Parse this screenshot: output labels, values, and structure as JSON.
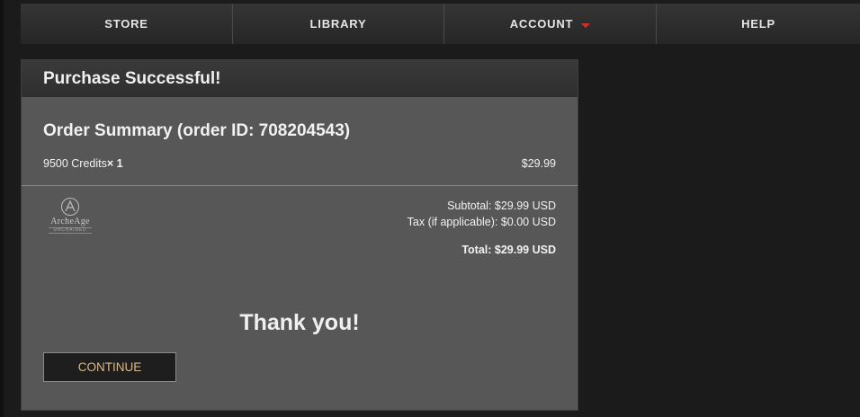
{
  "nav": {
    "items": [
      {
        "label": "STORE"
      },
      {
        "label": "LIBRARY"
      },
      {
        "label": "ACCOUNT"
      },
      {
        "label": "HELP"
      }
    ]
  },
  "panel": {
    "header": "Purchase Successful!",
    "order_summary": "Order Summary (order ID: 708204543)",
    "line_item": {
      "name": "9500 Credits",
      "qty": "× 1",
      "price": "$29.99"
    },
    "subtotal": "Subtotal: $29.99 USD",
    "tax": "Tax (if applicable): $0.00 USD",
    "total": "Total: $29.99 USD",
    "thank_you": "Thank you!",
    "continue_label": "CONTINUE"
  },
  "logo": {
    "name": "ArcheAge",
    "sub": "UNCHAINED"
  },
  "colors": {
    "background": "#1b1b1b",
    "panel": "#575757",
    "accent_caret": "#d32f2f",
    "continue_text": "#d9b98a"
  }
}
